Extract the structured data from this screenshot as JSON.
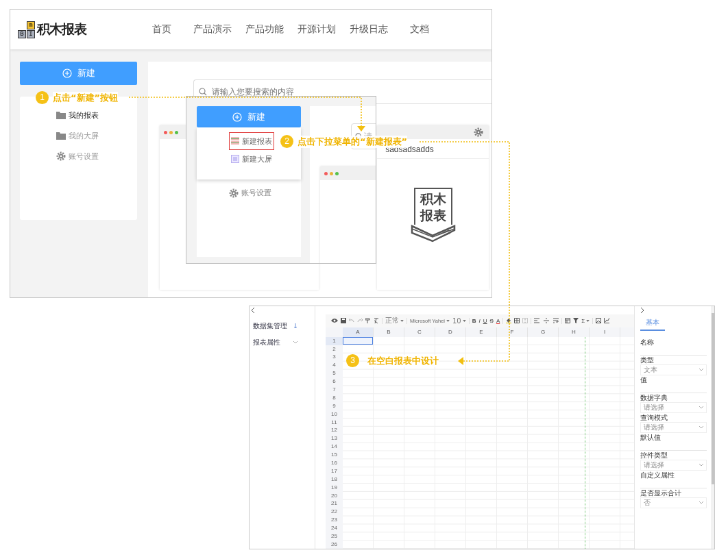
{
  "app": {
    "logo_blocks": [
      "m",
      "B",
      "I"
    ],
    "logo_text": "积木报表",
    "nav": [
      "首页",
      "产品演示",
      "产品功能",
      "开源计划",
      "升级日志",
      "文档"
    ],
    "new_button": "新建",
    "sidebar": [
      {
        "label": "我的报表",
        "kind": "folder",
        "selected": true
      },
      {
        "label": "我的大屏",
        "kind": "folder",
        "selected": false
      },
      {
        "label": "账号设置",
        "kind": "gear",
        "selected": false
      }
    ],
    "search": {
      "placeholder": "请输入您要搜索的内容"
    },
    "card": {
      "title": "sadsadsadds",
      "stamp": [
        "积木",
        "报表"
      ]
    }
  },
  "dropdown": {
    "button": "新建",
    "items": [
      {
        "label": "新建报表",
        "kind": "report",
        "highlighted": true
      },
      {
        "label": "新建大屏",
        "kind": "screen",
        "highlighted": false
      }
    ],
    "footer": "账号设置",
    "search_stub": "请"
  },
  "callouts": [
    {
      "number": "1",
      "text": "点击“新建”按钮"
    },
    {
      "number": "2",
      "text": "点击下拉菜单的“新建报表”"
    },
    {
      "number": "3",
      "text": "在空白报表中设计"
    }
  ],
  "designer": {
    "sidebar": [
      {
        "label": "数据集管理",
        "kind": "add"
      },
      {
        "label": "报表属性",
        "kind": "caret"
      }
    ],
    "toolbar": {
      "format": "正常",
      "font": "Microsoft Yahei",
      "size": "10",
      "glyphs": [
        "B",
        "I",
        "U",
        "S",
        "A"
      ],
      "sum": "Σ"
    },
    "columns": [
      "A",
      "B",
      "C",
      "D",
      "E",
      "F",
      "G",
      "H",
      "I"
    ],
    "rows": [
      "1",
      "2",
      "3",
      "4",
      "5",
      "6",
      "7",
      "8",
      "9",
      "10",
      "11",
      "12",
      "13",
      "14",
      "15",
      "16",
      "17",
      "18",
      "19",
      "20",
      "21",
      "22",
      "23",
      "24",
      "25",
      "26"
    ],
    "panel": {
      "tab": "基本",
      "fields": [
        {
          "label": "名称",
          "kind": "input"
        },
        {
          "label": "类型",
          "kind": "select",
          "value": "文本"
        },
        {
          "label": "值",
          "kind": "input"
        },
        {
          "label": "数据字典",
          "kind": "select",
          "value": "请选择"
        },
        {
          "label": "查询模式",
          "kind": "select",
          "value": "请选择"
        },
        {
          "label": "默认值",
          "kind": "input"
        },
        {
          "label": "控件类型",
          "kind": "select",
          "value": "请选择"
        },
        {
          "label": "自定义属性",
          "kind": "input"
        },
        {
          "label": "是否显示合计",
          "kind": "select",
          "value": "否"
        }
      ]
    }
  }
}
